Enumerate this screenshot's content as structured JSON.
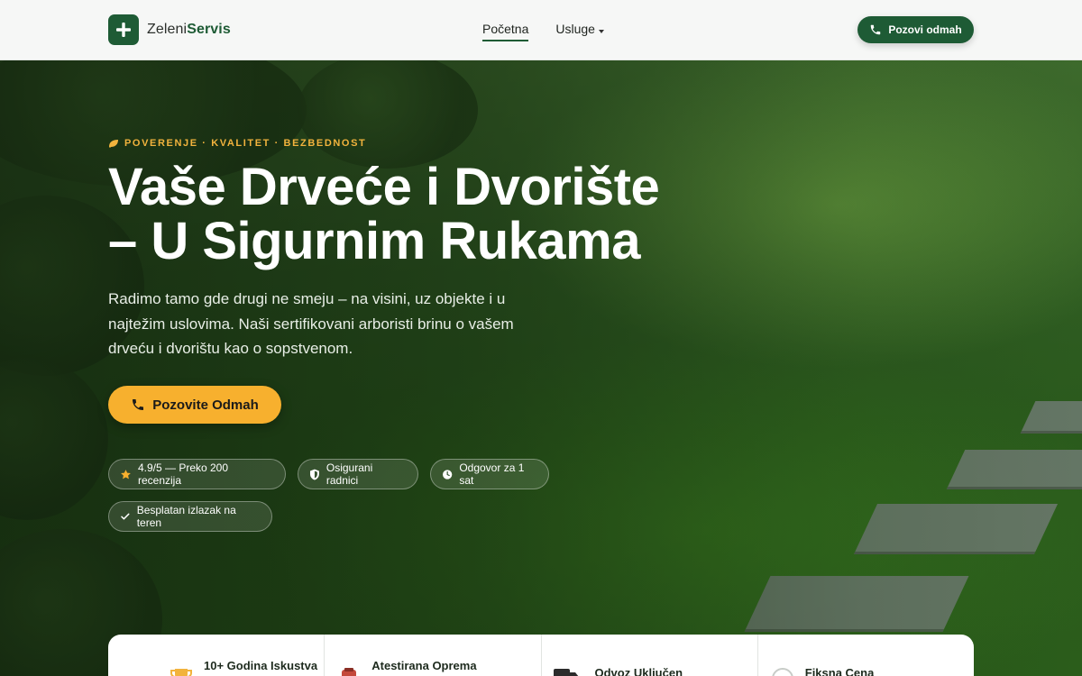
{
  "brand": {
    "name_part1": "Zeleni",
    "name_part2": "Servis",
    "accent_color": "#1e5b35"
  },
  "nav": {
    "home_label": "Početna",
    "services_label": "Usluge"
  },
  "header_call": {
    "label": "Pozovi odmah",
    "icon": "phone-icon"
  },
  "hero": {
    "eyebrow": "POVERENJE · KVALITET · BEZBEDNOST",
    "title_line1": "Vaše Drveće i Dvorište",
    "title_line2": "– U Sigurnim Rukama",
    "description": "Radimo tamo gde drugi ne smeju – na visini, uz objekte i u najtežim uslovima. Naši sertifikovani arboristi brinu o vašem drveću i dvorištu kao o sopstvenom.",
    "cta_label": "Pozovite Odmah",
    "cta_color": "#f7b02e"
  },
  "badges": [
    {
      "icon": "star-icon",
      "label": "4.9/5 — Preko 200 recenzija"
    },
    {
      "icon": "shield-icon",
      "label": "Osigurani radnici"
    },
    {
      "icon": "clock-icon",
      "label": "Odgovor za 1 sat"
    },
    {
      "icon": "check-icon",
      "label": "Besplatan izlazak na teren"
    }
  ],
  "features": [
    {
      "icon": "trophy-icon",
      "label": "10+ Godina Iskustva"
    },
    {
      "icon": "equipment-icon",
      "label": "Atestirana Oprema"
    },
    {
      "icon": "truck-icon",
      "label": "Odvoz Uključen"
    },
    {
      "icon": "price-icon",
      "label": "Fiksna Cena"
    }
  ]
}
